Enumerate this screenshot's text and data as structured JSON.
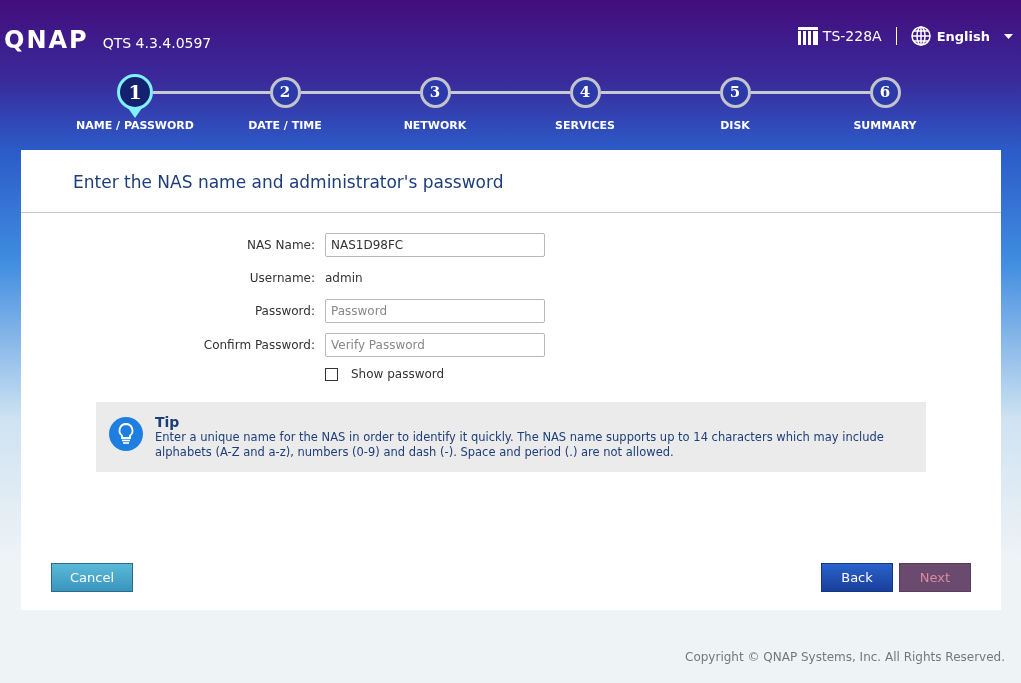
{
  "header": {
    "logo": "QNAP",
    "version": "QTS 4.3.4.0597",
    "device": "TS-228A",
    "language": "English"
  },
  "steps": [
    {
      "number": "1",
      "label": "NAME / PASSWORD",
      "selected": true
    },
    {
      "number": "2",
      "label": "DATE / TIME",
      "selected": false
    },
    {
      "number": "3",
      "label": "NETWORK",
      "selected": false
    },
    {
      "number": "4",
      "label": "SERVICES",
      "selected": false
    },
    {
      "number": "5",
      "label": "DISK",
      "selected": false
    },
    {
      "number": "6",
      "label": "SUMMARY",
      "selected": false
    }
  ],
  "panel": {
    "title": "Enter the NAS name and administrator's password",
    "fields": [
      {
        "kind": "input",
        "label": "NAS Name:",
        "value": "NAS1D98FC"
      },
      {
        "kind": "text",
        "label": "Username:",
        "value": "admin"
      },
      {
        "kind": "input",
        "label": "Password:",
        "placeholder": "Password"
      },
      {
        "kind": "input",
        "label": "Confirm Password:",
        "placeholder": "Verify Password"
      }
    ],
    "show_password": {
      "label": "Show password",
      "checked": false
    },
    "tip": {
      "title": "Tip",
      "text": "Enter a unique name for the NAS in order to identify it quickly. The NAS name supports up to 14 characters which may include alphabets (A-Z and a-z), numbers (0-9) and dash (-). Space and period (.) are not allowed."
    },
    "buttons": [
      {
        "kind": "cancel",
        "label": "Cancel",
        "disabled": false
      },
      {
        "kind": "back",
        "label": "Back",
        "disabled": false
      },
      {
        "kind": "next",
        "label": "Next",
        "disabled": true
      }
    ]
  },
  "footer": {
    "copyright": "Copyright © QNAP Systems, Inc. All Rights Reserved."
  }
}
